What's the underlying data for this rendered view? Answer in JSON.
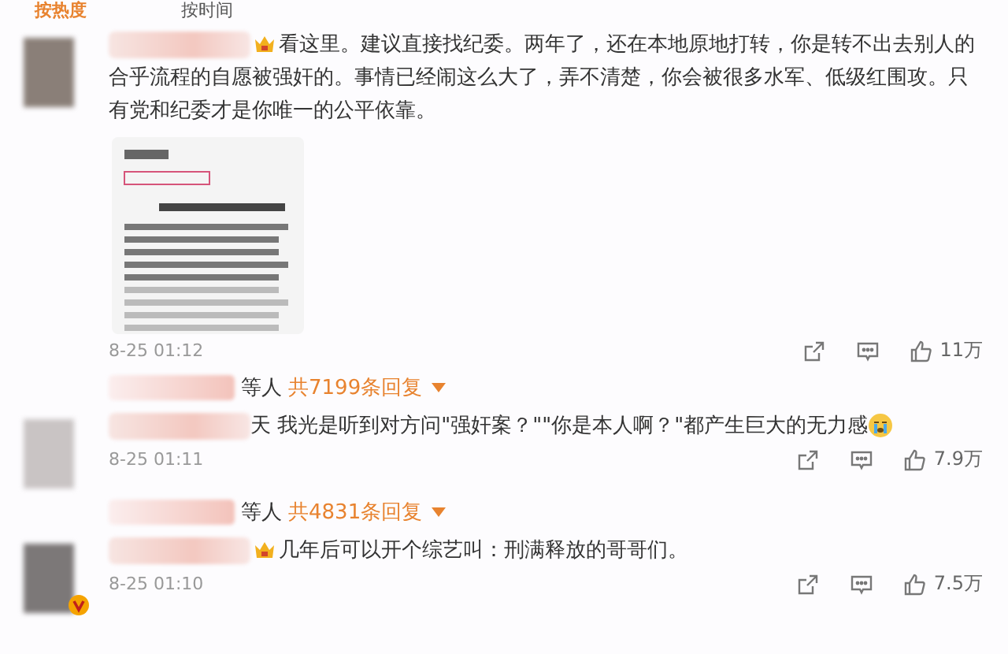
{
  "tabs": [
    {
      "label": "按热度",
      "selected": true
    },
    {
      "label": "按时间",
      "selected": false
    }
  ],
  "comments": [
    {
      "vip_badge": true,
      "verified": false,
      "text": "看这里。建议直接找纪委。两年了，还在本地原地打转，你是转不出去别人的合乎流程的自愿被强奸的。事情已经闹这么大了，弄不清楚，你会被很多水军、低级红围攻。只有党和纪委才是你唯一的公平依靠。",
      "end_emoji": false,
      "time": "8-25 01:12",
      "likes": "11万",
      "replies": {
        "suffix": "等人",
        "count": "共7199条回复"
      }
    },
    {
      "vip_badge": false,
      "verified": false,
      "text": "天 我光是听到对方问\"强奸案？\"\"你是本人啊？\"都产生巨大的无力感",
      "end_emoji": true,
      "time": "8-25 01:11",
      "likes": "7.9万",
      "replies": {
        "suffix": "等人",
        "count": "共4831条回复"
      }
    },
    {
      "vip_badge": true,
      "verified": true,
      "text": "几年后可以开个综艺叫：刑满释放的哥哥们。",
      "end_emoji": false,
      "time": "8-25 01:10",
      "likes": "7.5万"
    }
  ]
}
